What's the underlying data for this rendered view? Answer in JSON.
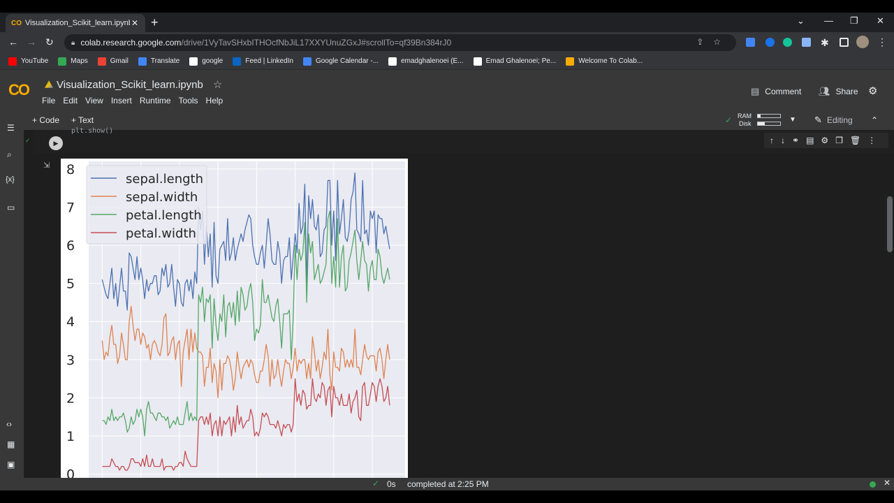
{
  "browser": {
    "tab_title": "Visualization_Scikit_learn.ipynb -",
    "tab_favicon": "CO",
    "url_host": "colab.research.google.com",
    "url_path": "/drive/1VyTavSHxbITHOcfNbJiL17XXYUnuZGxJ#scrollTo=qf39Bn384rJ0"
  },
  "bookmarks": [
    {
      "label": "YouTube",
      "icon": "youtube-icon",
      "color": "#ff0000"
    },
    {
      "label": "Maps",
      "icon": "maps-icon",
      "color": "#34a853"
    },
    {
      "label": "Gmail",
      "icon": "gmail-icon",
      "color": "#ea4335"
    },
    {
      "label": "Translate",
      "icon": "translate-icon",
      "color": "#4285f4"
    },
    {
      "label": "google",
      "icon": "google-icon",
      "color": "#ffffff"
    },
    {
      "label": "Feed | LinkedIn",
      "icon": "linkedin-icon",
      "color": "#0a66c2"
    },
    {
      "label": "Google Calendar -...",
      "icon": "calendar-icon",
      "color": "#4285f4"
    },
    {
      "label": "emadghalenoei (E...",
      "icon": "github-icon",
      "color": "#ffffff"
    },
    {
      "label": "Emad Ghalenoei; Pe...",
      "icon": "profile-icon",
      "color": "#ffffff"
    },
    {
      "label": "Welcome To Colab...",
      "icon": "colab-icon",
      "color": "#f9ab00"
    }
  ],
  "colab": {
    "logo": "CO",
    "notebook_name": "Visualization_Scikit_learn.ipynb",
    "menu": [
      "File",
      "Edit",
      "View",
      "Insert",
      "Runtime",
      "Tools",
      "Help"
    ],
    "comment_label": "Comment",
    "share_label": "Share",
    "add_code": "+ Code",
    "add_text": "+ Text",
    "ram_label": "RAM",
    "disk_label": "Disk",
    "ram_fraction": 0.12,
    "disk_fraction": 0.3,
    "editing_label": "Editing",
    "code_line": "plt.show()",
    "status_duration": "0s",
    "status_text": "completed at 2:25 PM"
  },
  "chart_data": {
    "type": "line",
    "title": "",
    "xlabel": "",
    "ylabel": "",
    "y_ticks": [
      "0",
      "1",
      "2",
      "3",
      "4",
      "5",
      "6",
      "7",
      "8"
    ],
    "ylim": [
      -0.1,
      8.2
    ],
    "xlim": [
      -7,
      157
    ],
    "grid": true,
    "legend_placement": "top-left",
    "legend_entries": [
      "sepal.length",
      "sepal.width",
      "petal.length",
      "petal.width"
    ],
    "series": [
      {
        "name": "sepal.length",
        "color": "#4c72b0",
        "values": [
          5.1,
          4.9,
          4.7,
          4.6,
          5.0,
          5.4,
          4.6,
          5.0,
          4.4,
          4.9,
          5.4,
          4.8,
          4.8,
          4.3,
          5.8,
          5.7,
          5.4,
          5.1,
          5.7,
          5.1,
          5.4,
          5.1,
          4.6,
          5.1,
          4.8,
          5.0,
          5.0,
          5.2,
          5.2,
          4.7,
          4.8,
          5.4,
          5.2,
          5.5,
          4.9,
          5.0,
          5.5,
          4.9,
          4.4,
          5.1,
          5.0,
          4.5,
          4.4,
          5.0,
          5.1,
          4.8,
          5.1,
          4.6,
          5.3,
          5.0,
          7.0,
          6.4,
          6.9,
          5.5,
          6.5,
          5.7,
          6.3,
          4.9,
          6.6,
          5.2,
          5.0,
          5.9,
          6.0,
          6.1,
          5.6,
          6.7,
          5.6,
          5.8,
          6.2,
          5.6,
          5.9,
          6.1,
          6.3,
          6.1,
          6.4,
          6.6,
          6.8,
          6.7,
          6.0,
          5.7,
          5.5,
          5.5,
          5.8,
          6.0,
          5.4,
          6.0,
          6.7,
          6.3,
          5.6,
          5.5,
          5.5,
          6.1,
          5.8,
          5.0,
          5.6,
          5.7,
          5.7,
          6.2,
          5.1,
          5.7,
          6.3,
          5.8,
          7.1,
          6.3,
          6.5,
          7.6,
          4.9,
          7.3,
          6.7,
          7.2,
          6.5,
          6.4,
          6.8,
          5.7,
          5.8,
          6.4,
          6.5,
          7.7,
          7.7,
          6.0,
          6.9,
          5.6,
          7.7,
          6.3,
          6.7,
          7.2,
          6.2,
          6.1,
          6.4,
          7.2,
          7.4,
          7.9,
          6.4,
          6.3,
          6.1,
          7.7,
          6.3,
          6.4,
          6.0,
          6.9,
          6.7,
          6.9,
          5.8,
          6.8,
          6.7,
          6.7,
          6.3,
          6.5,
          6.2,
          5.9
        ]
      },
      {
        "name": "sepal.width",
        "color": "#dd8452",
        "values": [
          3.5,
          3.0,
          3.2,
          3.1,
          3.6,
          3.9,
          3.4,
          3.4,
          2.9,
          3.1,
          3.7,
          3.4,
          3.0,
          3.0,
          4.0,
          4.4,
          3.9,
          3.5,
          3.8,
          3.8,
          3.4,
          3.7,
          3.6,
          3.3,
          3.4,
          3.0,
          3.4,
          3.5,
          3.4,
          3.2,
          3.1,
          3.4,
          4.1,
          4.2,
          3.1,
          3.2,
          3.5,
          3.6,
          3.0,
          3.4,
          3.5,
          2.3,
          3.2,
          3.5,
          3.8,
          3.0,
          3.8,
          3.2,
          3.7,
          3.3,
          3.2,
          3.2,
          3.1,
          2.3,
          2.8,
          2.8,
          3.3,
          2.4,
          2.9,
          2.7,
          2.0,
          3.0,
          2.2,
          2.9,
          2.9,
          3.1,
          3.0,
          2.7,
          2.2,
          2.5,
          3.2,
          2.8,
          2.5,
          2.8,
          2.9,
          3.0,
          2.8,
          3.0,
          2.9,
          2.6,
          2.4,
          2.4,
          2.7,
          2.7,
          3.0,
          3.4,
          3.1,
          2.3,
          3.0,
          2.5,
          2.6,
          3.0,
          2.6,
          2.3,
          2.7,
          3.0,
          2.9,
          2.9,
          2.5,
          2.8,
          3.3,
          2.7,
          3.0,
          2.9,
          3.0,
          3.0,
          2.5,
          2.9,
          2.5,
          3.6,
          3.2,
          2.7,
          3.0,
          2.5,
          2.8,
          3.2,
          3.0,
          3.8,
          2.6,
          2.2,
          3.2,
          2.8,
          2.8,
          2.7,
          3.3,
          3.2,
          2.8,
          3.0,
          2.8,
          3.0,
          2.8,
          3.8,
          2.8,
          2.8,
          2.6,
          3.0,
          3.4,
          3.1,
          3.0,
          3.1,
          3.1,
          3.1,
          2.7,
          3.2,
          3.3,
          3.0,
          2.5,
          3.0,
          3.4,
          3.0
        ]
      },
      {
        "name": "petal.length",
        "color": "#55a868",
        "values": [
          1.4,
          1.4,
          1.3,
          1.5,
          1.4,
          1.7,
          1.4,
          1.5,
          1.4,
          1.5,
          1.5,
          1.6,
          1.4,
          1.1,
          1.2,
          1.5,
          1.3,
          1.4,
          1.7,
          1.5,
          1.7,
          1.5,
          1.0,
          1.7,
          1.9,
          1.6,
          1.6,
          1.5,
          1.4,
          1.6,
          1.6,
          1.5,
          1.5,
          1.4,
          1.5,
          1.2,
          1.3,
          1.4,
          1.3,
          1.5,
          1.3,
          1.3,
          1.3,
          1.6,
          1.9,
          1.4,
          1.6,
          1.4,
          1.5,
          1.4,
          4.7,
          4.5,
          4.9,
          4.0,
          4.6,
          4.5,
          4.7,
          3.3,
          4.6,
          3.9,
          3.5,
          4.2,
          4.0,
          4.7,
          3.6,
          4.4,
          4.5,
          4.1,
          4.5,
          3.9,
          4.8,
          4.0,
          4.9,
          4.7,
          4.3,
          4.4,
          4.8,
          5.0,
          4.5,
          3.5,
          3.8,
          3.7,
          3.9,
          5.1,
          4.5,
          4.5,
          4.7,
          4.4,
          4.1,
          4.0,
          4.4,
          4.6,
          4.0,
          3.3,
          4.2,
          4.2,
          4.2,
          4.3,
          3.0,
          4.1,
          6.0,
          5.1,
          5.9,
          5.6,
          5.8,
          6.6,
          4.5,
          6.3,
          5.8,
          6.1,
          5.1,
          5.3,
          5.5,
          5.0,
          5.1,
          5.3,
          5.5,
          6.7,
          6.9,
          5.0,
          5.7,
          4.9,
          6.7,
          4.9,
          5.7,
          6.0,
          4.8,
          4.9,
          5.6,
          5.8,
          6.1,
          6.4,
          5.6,
          5.1,
          5.6,
          6.1,
          5.6,
          5.5,
          4.8,
          5.4,
          5.6,
          5.1,
          5.1,
          5.9,
          5.7,
          5.2,
          5.0,
          5.2,
          5.4,
          5.1
        ]
      },
      {
        "name": "petal.width",
        "color": "#c44e52",
        "values": [
          0.2,
          0.2,
          0.2,
          0.2,
          0.2,
          0.4,
          0.3,
          0.2,
          0.2,
          0.1,
          0.2,
          0.2,
          0.1,
          0.1,
          0.2,
          0.4,
          0.4,
          0.3,
          0.3,
          0.3,
          0.2,
          0.4,
          0.2,
          0.5,
          0.2,
          0.2,
          0.4,
          0.2,
          0.2,
          0.2,
          0.2,
          0.4,
          0.1,
          0.2,
          0.2,
          0.2,
          0.2,
          0.1,
          0.2,
          0.2,
          0.3,
          0.3,
          0.2,
          0.6,
          0.4,
          0.3,
          0.2,
          0.2,
          0.2,
          0.2,
          1.4,
          1.5,
          1.5,
          1.3,
          1.5,
          1.3,
          1.6,
          1.0,
          1.3,
          1.4,
          1.0,
          1.5,
          1.0,
          1.4,
          1.3,
          1.4,
          1.5,
          1.0,
          1.5,
          1.1,
          1.8,
          1.3,
          1.5,
          1.2,
          1.3,
          1.4,
          1.4,
          1.7,
          1.5,
          1.0,
          1.1,
          1.0,
          1.2,
          1.6,
          1.5,
          1.6,
          1.5,
          1.3,
          1.3,
          1.3,
          1.2,
          1.4,
          1.2,
          1.0,
          1.3,
          1.2,
          1.3,
          1.3,
          1.1,
          1.3,
          2.5,
          1.9,
          2.1,
          1.8,
          2.2,
          2.1,
          1.7,
          1.8,
          1.8,
          2.5,
          2.0,
          1.9,
          2.1,
          2.0,
          2.4,
          2.3,
          1.8,
          2.2,
          2.3,
          1.5,
          2.3,
          2.0,
          2.0,
          1.8,
          2.1,
          1.8,
          1.8,
          1.8,
          2.1,
          1.6,
          1.9,
          2.0,
          2.2,
          1.5,
          1.4,
          2.3,
          2.4,
          1.8,
          1.8,
          2.1,
          2.4,
          2.3,
          1.9,
          2.3,
          2.5,
          2.3,
          1.9,
          2.0,
          2.3,
          1.8
        ]
      }
    ]
  }
}
